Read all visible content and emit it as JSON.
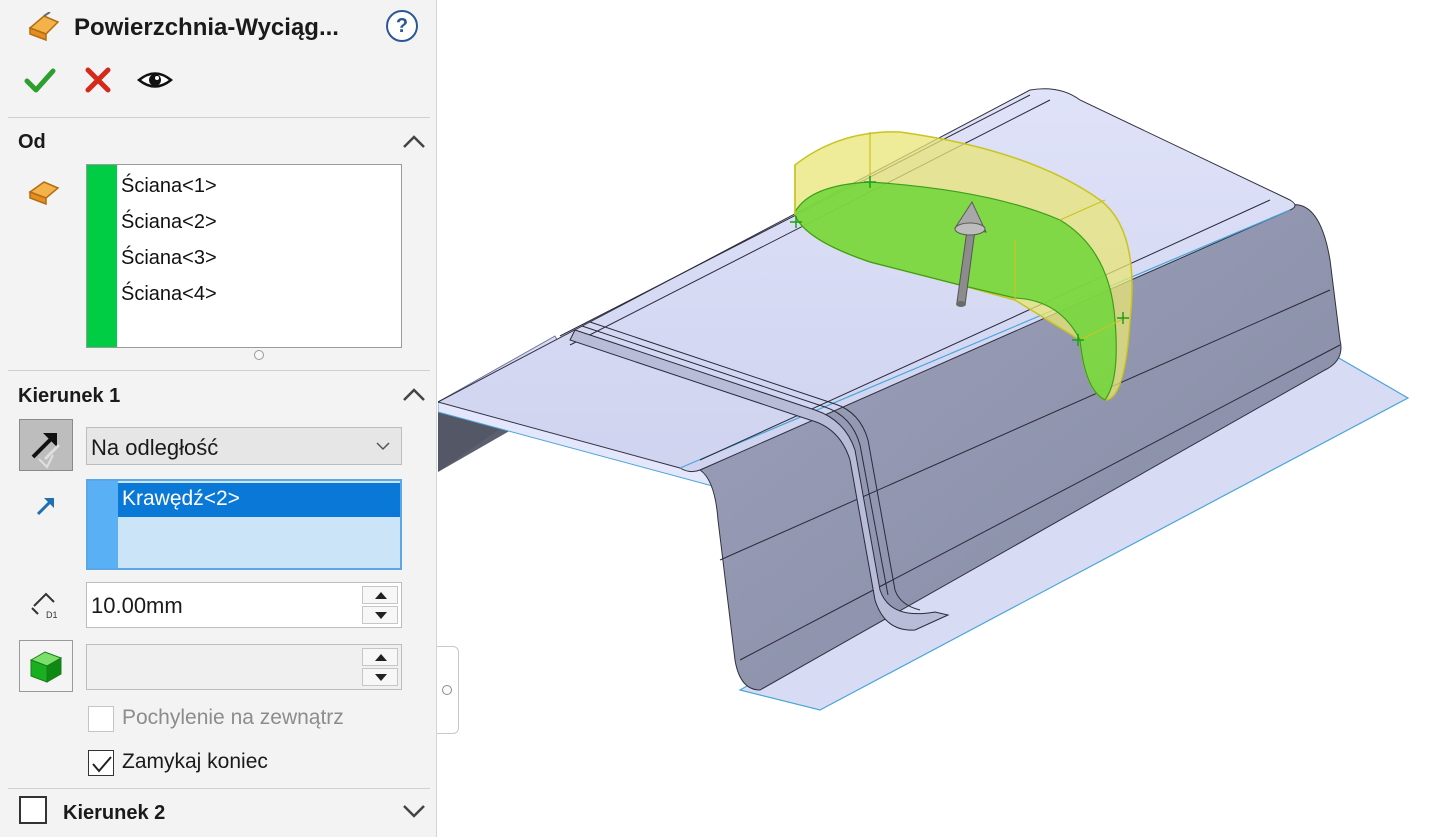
{
  "feature": {
    "title": "Powierzchnia-Wyciąg...",
    "help_label": "?",
    "feature_icon": "surface-extrude-icon",
    "ok_icon": "checkmark-icon",
    "cancel_icon": "close-icon",
    "preview_icon": "eye-icon"
  },
  "from_group": {
    "title": "Od",
    "items": [
      "Ściana<1>",
      "Ściana<2>",
      "Ściana<3>",
      "Ściana<4>"
    ],
    "selection_color": "#00cc44"
  },
  "direction1": {
    "title": "Kierunek 1",
    "end_condition": "Na odległość",
    "direction_items": [
      "Krawędź<2>"
    ],
    "distance_value": "10.00mm",
    "draft_value": "",
    "draft_outward_label": "Pochylenie na zewnątrz",
    "draft_outward_checked": false,
    "cap_end_label": "Zamykaj koniec",
    "cap_end_checked": true
  },
  "direction2": {
    "title": "Kierunek 2",
    "checked": false
  },
  "colors": {
    "accent": "#0a78d7",
    "selection_green": "#00cc44",
    "ok_green": "#2e9e2e",
    "cancel_red": "#d42a1c"
  }
}
